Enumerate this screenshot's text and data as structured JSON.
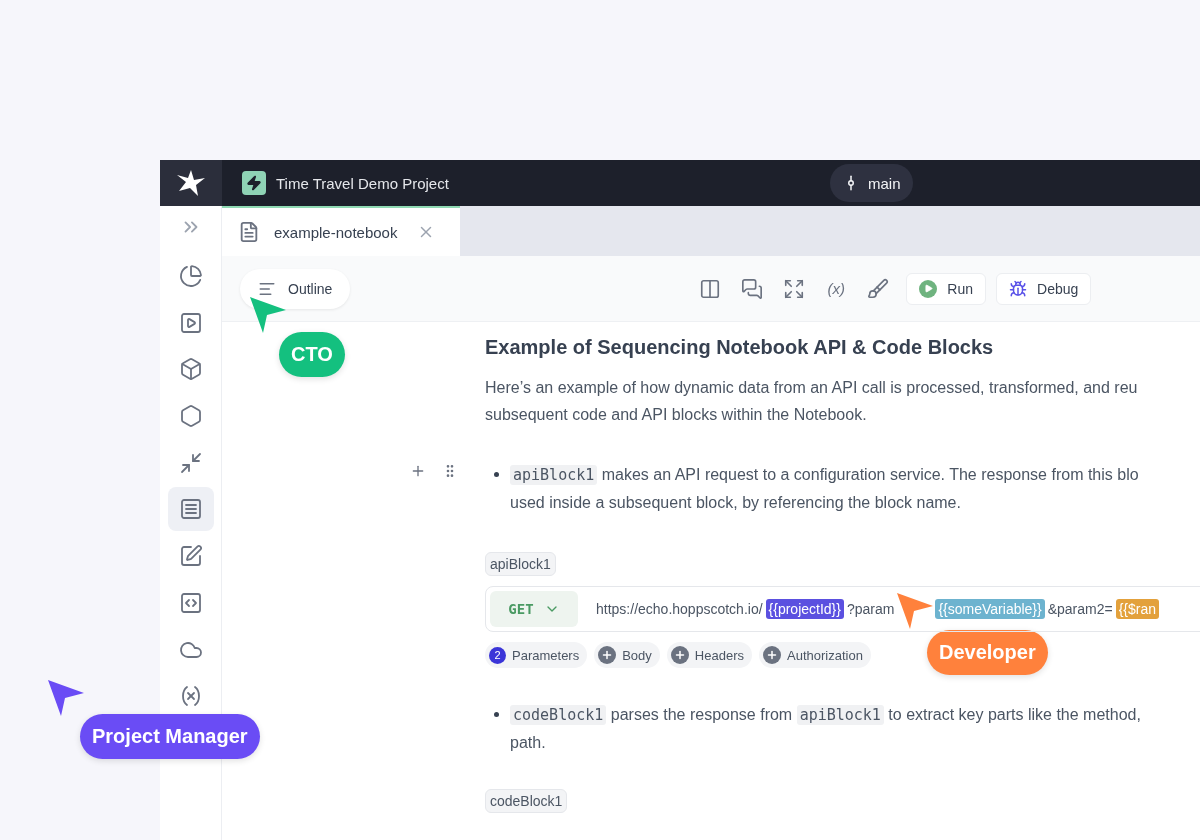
{
  "topbar": {
    "project": "Time Travel Demo Project",
    "branch": "main"
  },
  "tabs": [
    {
      "label": "example-notebook",
      "selected": true
    }
  ],
  "sidebar": {
    "items": [
      {
        "kind": "radar",
        "selected": false
      },
      {
        "kind": "play",
        "selected": false
      },
      {
        "kind": "box",
        "selected": false
      },
      {
        "kind": "hexagon",
        "selected": false
      },
      {
        "kind": "shrink",
        "selected": false
      },
      {
        "kind": "notebook",
        "selected": true
      },
      {
        "kind": "sign",
        "selected": false
      },
      {
        "kind": "code",
        "selected": false
      },
      {
        "kind": "cloud",
        "selected": false
      },
      {
        "kind": "variable",
        "selected": false
      }
    ]
  },
  "toolbar": {
    "outline": "Outline",
    "tools": [
      {
        "kind": "panel"
      },
      {
        "kind": "comments"
      },
      {
        "kind": "expand"
      },
      {
        "kind": "variable",
        "label": "(x)"
      },
      {
        "kind": "broom"
      }
    ],
    "buttons": [
      {
        "kind": "run",
        "label": "Run"
      },
      {
        "kind": "debug",
        "label": "Debug"
      }
    ]
  },
  "document": {
    "heading": "Example of Sequencing Notebook API & Code Blocks",
    "intro_lines": [
      "Here’s an example of how dynamic data from an API call is processed, transformed, and reu",
      "subsequent code and API blocks within the Notebook."
    ],
    "blocks": [
      {
        "kind": "bullet",
        "lines": [
          [
            {
              "kind": "code",
              "text": "apiBlock1"
            },
            {
              "kind": "text",
              "text": " makes an API request to a configuration service. The response from this blo"
            }
          ],
          [
            {
              "kind": "text",
              "text": "used inside a subsequent block, by referencing the block name."
            }
          ]
        ]
      },
      {
        "kind": "request",
        "name": "apiBlock1",
        "method": "GET",
        "url": [
          {
            "kind": "text",
            "text": "https://echo.hoppscotch.io/"
          },
          {
            "kind": "variable",
            "text": "{{projectId}}",
            "color": "#5b50e0"
          },
          {
            "kind": "text",
            "text": "?param"
          },
          {
            "kind": "variable",
            "text": "{{someVariable}}",
            "color": "#6db3cf"
          },
          {
            "kind": "text",
            "text": "&param2="
          },
          {
            "kind": "variable",
            "text": "{{$ran",
            "color": "#e3a13c"
          }
        ],
        "chips": [
          {
            "label": "Parameters",
            "count": "2"
          },
          {
            "label": "Body"
          },
          {
            "label": "Headers"
          },
          {
            "label": "Authorization"
          }
        ]
      },
      {
        "kind": "bullet",
        "lines": [
          [
            {
              "kind": "code",
              "text": "codeBlock1"
            },
            {
              "kind": "text",
              "text": " parses the response from "
            },
            {
              "kind": "code",
              "text": "apiBlock1"
            },
            {
              "kind": "text",
              "text": " to extract key parts like the method,"
            }
          ],
          [
            {
              "kind": "text",
              "text": "path."
            }
          ]
        ]
      },
      {
        "kind": "label",
        "name": "codeBlock1"
      }
    ]
  },
  "cursors": [
    {
      "label": "CTO",
      "color": "#14c07f"
    },
    {
      "label": "Developer",
      "color": "#ff813c"
    },
    {
      "label": "Project Manager",
      "color": "#6a4cf5"
    }
  ]
}
